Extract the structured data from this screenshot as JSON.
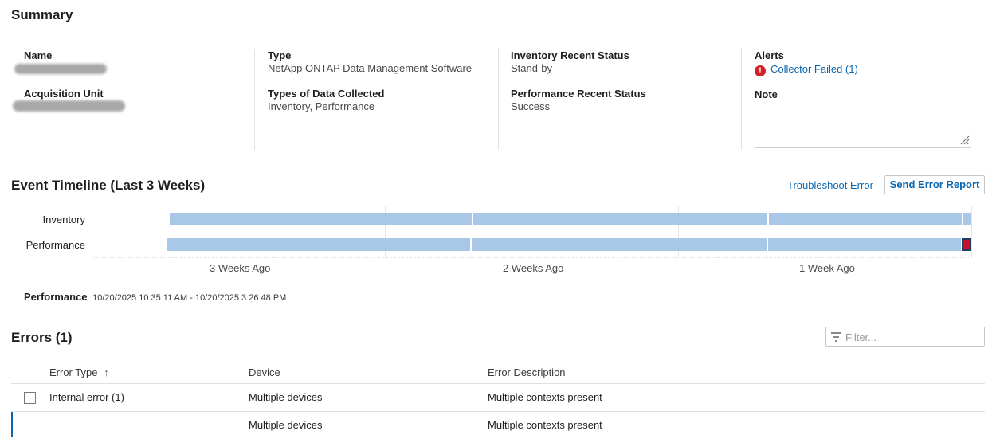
{
  "summary": {
    "title": "Summary",
    "name_label": "Name",
    "acq_label": "Acquisition Unit",
    "type_label": "Type",
    "type_value": "NetApp ONTAP Data Management Software",
    "types_label": "Types of Data Collected",
    "types_value": "Inventory, Performance",
    "inv_status_label": "Inventory Recent Status",
    "inv_status_value": "Stand-by",
    "perf_status_label": "Performance Recent Status",
    "perf_status_value": "Success",
    "alerts_label": "Alerts",
    "alert_icon_glyph": "!",
    "alert_link": "Collector Failed (1)",
    "note_label": "Note"
  },
  "timeline": {
    "title": "Event Timeline (Last 3 Weeks)",
    "troubleshoot": "Troubleshoot Error",
    "send_report": "Send Error Report",
    "rows": [
      "Inventory",
      "Performance"
    ],
    "ticks": [
      "3 Weeks Ago",
      "2 Weeks Ago",
      "1 Week Ago"
    ],
    "bar_color": "#a9c8e8",
    "failure_color": "#c8102e",
    "detail_label": "Performance",
    "detail_value": "10/20/2025 10:35:11 AM - 10/20/2025 3:26:48 PM"
  },
  "errors": {
    "title": "Errors (1)",
    "filter_placeholder": "Filter...",
    "columns": [
      "Error Type",
      "Device",
      "Error Description"
    ],
    "sort_icon": "↑",
    "group_row": {
      "type": "Internal error (1)",
      "device": "Multiple devices",
      "desc": "Multiple contexts present"
    },
    "child_row": {
      "device": "Multiple devices",
      "desc": "Multiple contexts present"
    }
  }
}
